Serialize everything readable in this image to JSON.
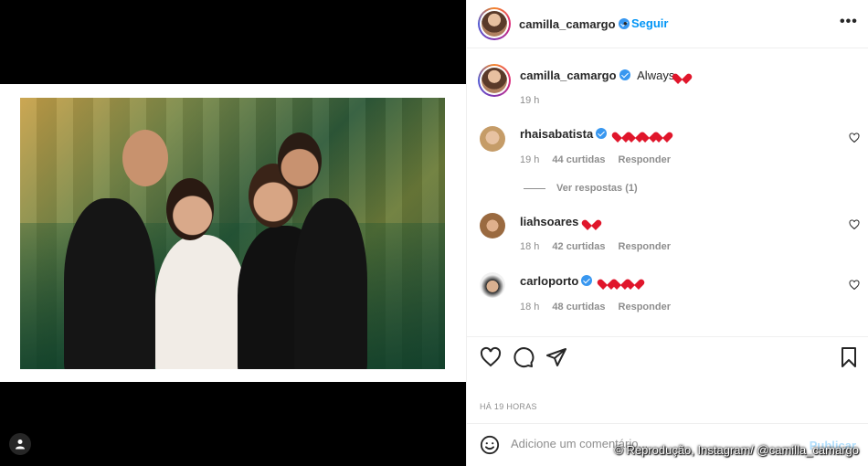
{
  "post": {
    "author": "camilla_camargo",
    "follow_label": "Seguir",
    "dot": "•",
    "more": "•••"
  },
  "caption": {
    "author": "camilla_camargo",
    "text": "Always",
    "time": "19 h"
  },
  "comments": [
    {
      "user": "rhaisabatista",
      "verified": true,
      "hearts": 4,
      "time": "19 h",
      "likes": "44 curtidas",
      "reply": "Responder",
      "view_replies": "Ver respostas (1)"
    },
    {
      "user": "liahsoares",
      "verified": false,
      "hearts": 1,
      "time": "18 h",
      "likes": "42 curtidas",
      "reply": "Responder"
    },
    {
      "user": "carloporto",
      "verified": true,
      "hearts": 3,
      "time": "18 h",
      "likes": "48 curtidas",
      "reply": "Responder"
    }
  ],
  "timestamp": "HÁ 19 HORAS",
  "composer": {
    "placeholder": "Adicione um comentário...",
    "publish": "Publicar"
  },
  "credit": "© Reprodução, Instagram/ @camilla_camargo",
  "colors": {
    "accent": "#0095f6",
    "heart": "#e0162b",
    "verified": "#3897f0",
    "muted": "#8e8e8e"
  },
  "icons": [
    "heart-icon",
    "comment-icon",
    "share-icon",
    "bookmark-icon",
    "emoji-icon",
    "tag-user-icon",
    "verified-badge-icon"
  ]
}
